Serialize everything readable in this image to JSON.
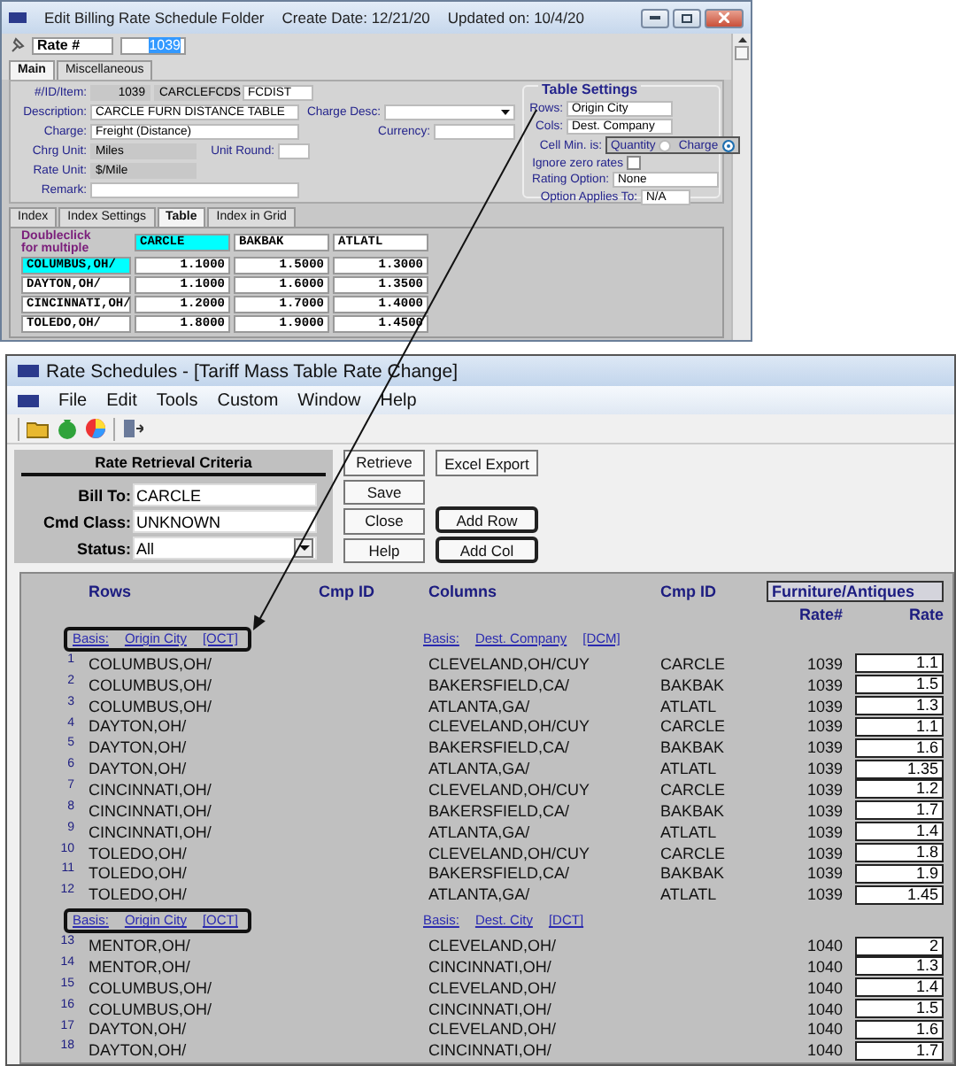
{
  "top_window": {
    "title": "Edit Billing Rate Schedule Folder",
    "create_date": "Create Date: 12/21/20",
    "updated_on": "Updated on: 10/4/20",
    "rate_label": "Rate #",
    "rate_value": "1039",
    "tabs": [
      {
        "label": "Main",
        "selected": true
      },
      {
        "label": "Miscellaneous",
        "selected": false
      }
    ],
    "form": {
      "id_item": {
        "label": "#/ID/Item:",
        "values": [
          "1039",
          "CARCLEFCDS",
          "FCDIST"
        ]
      },
      "description": {
        "label": "Description:",
        "value": "CARCLE FURN DISTANCE TABLE"
      },
      "charge_desc": {
        "label": "Charge Desc:"
      },
      "charge": {
        "label": "Charge:",
        "value": "Freight (Distance)"
      },
      "currency": {
        "label": "Currency:"
      },
      "chrg_unit": {
        "label": "Chrg Unit:",
        "value": "Miles"
      },
      "unit_round": {
        "label": "Unit Round:"
      },
      "rate_unit": {
        "label": "Rate Unit:",
        "value": "$/Mile"
      },
      "remark": {
        "label": "Remark:"
      }
    },
    "table_settings": {
      "title": "Table Settings",
      "rows": {
        "label": "Rows:",
        "value": "Origin City"
      },
      "cols": {
        "label": "Cols:",
        "value": "Dest. Company"
      },
      "cell_min": {
        "label": "Cell Min. is:",
        "options": [
          {
            "label": "Quantity",
            "selected": false
          },
          {
            "label": "Charge",
            "selected": true
          }
        ]
      },
      "ignore_zero": {
        "label": "Ignore zero rates",
        "checked": false
      },
      "rating_option": {
        "label": "Rating Option:",
        "value": "None"
      },
      "option_applies": {
        "label": "Option Applies To:",
        "value": "N/A"
      }
    },
    "inner_tabs": [
      {
        "label": "Index",
        "selected": false
      },
      {
        "label": "Index Settings",
        "selected": false
      },
      {
        "label": "Table",
        "selected": true
      },
      {
        "label": "Index in Grid",
        "selected": false
      }
    ],
    "grid": {
      "hint": "Doubleclick",
      "hint_2": "for multiple",
      "columns": [
        {
          "label": "CARCLE",
          "selected": true
        },
        {
          "label": "BAKBAK",
          "selected": false
        },
        {
          "label": "ATLATL",
          "selected": false
        }
      ],
      "rows": [
        {
          "label": "COLUMBUS,OH/",
          "selected": true,
          "values": [
            "1.1000",
            "1.5000",
            "1.3000"
          ]
        },
        {
          "label": "DAYTON,OH/",
          "selected": false,
          "values": [
            "1.1000",
            "1.6000",
            "1.3500"
          ]
        },
        {
          "label": "CINCINNATI,OH/",
          "selected": false,
          "values": [
            "1.2000",
            "1.7000",
            "1.4000"
          ]
        },
        {
          "label": "TOLEDO,OH/",
          "selected": false,
          "values": [
            "1.8000",
            "1.9000",
            "1.4500"
          ]
        }
      ]
    }
  },
  "bottom_window": {
    "title": "Rate Schedules - [Tariff Mass Table Rate Change]",
    "menu": [
      "File",
      "Edit",
      "Tools",
      "Custom",
      "Window",
      "Help"
    ],
    "criteria": {
      "title": "Rate Retrieval Criteria",
      "fields": [
        {
          "kind": "text",
          "label": "Bill To:",
          "value": "CARCLE"
        },
        {
          "kind": "text",
          "label": "Cmd Class:",
          "value": "UNKNOWN"
        },
        {
          "kind": "select",
          "label": "Status:",
          "value": "All"
        }
      ]
    },
    "button_columns": [
      [
        {
          "label": "Retrieve",
          "emphasized": false
        },
        {
          "label": "Save",
          "emphasized": false
        },
        {
          "label": "Close",
          "emphasized": false
        },
        {
          "label": "Help",
          "emphasized": false
        }
      ],
      [
        {
          "label": "Excel Export",
          "emphasized": false
        },
        {
          "label": "Add Row",
          "emphasized": true
        },
        {
          "label": "Add Col",
          "emphasized": true
        }
      ]
    ],
    "table": {
      "headers": {
        "rows": "Rows",
        "cmp_id_1": "Cmp ID",
        "columns": "Columns",
        "cmp_id_2": "Cmp ID",
        "category": "Furniture/Antiques",
        "rate_no": "Rate#",
        "rate": "Rate"
      },
      "groups": [
        {
          "highlighted": true,
          "row_basis": {
            "label": "Basis:",
            "name": "Origin City",
            "code": "[OCT]"
          },
          "col_basis": {
            "label": "Basis:",
            "name": "Dest. Company",
            "code": "[DCM]"
          },
          "rows": [
            {
              "no": "1",
              "row": "COLUMBUS,OH/",
              "column": "CLEVELAND,OH/CUY",
              "cmp_id": "CARCLE",
              "rate_no": "1039",
              "rate": "1.1"
            },
            {
              "no": "2",
              "row": "COLUMBUS,OH/",
              "column": "BAKERSFIELD,CA/",
              "cmp_id": "BAKBAK",
              "rate_no": "1039",
              "rate": "1.5"
            },
            {
              "no": "3",
              "row": "COLUMBUS,OH/",
              "column": "ATLANTA,GA/",
              "cmp_id": "ATLATL",
              "rate_no": "1039",
              "rate": "1.3"
            },
            {
              "no": "4",
              "row": "DAYTON,OH/",
              "column": "CLEVELAND,OH/CUY",
              "cmp_id": "CARCLE",
              "rate_no": "1039",
              "rate": "1.1"
            },
            {
              "no": "5",
              "row": "DAYTON,OH/",
              "column": "BAKERSFIELD,CA/",
              "cmp_id": "BAKBAK",
              "rate_no": "1039",
              "rate": "1.6"
            },
            {
              "no": "6",
              "row": "DAYTON,OH/",
              "column": "ATLANTA,GA/",
              "cmp_id": "ATLATL",
              "rate_no": "1039",
              "rate": "1.35"
            },
            {
              "no": "7",
              "row": "CINCINNATI,OH/",
              "column": "CLEVELAND,OH/CUY",
              "cmp_id": "CARCLE",
              "rate_no": "1039",
              "rate": "1.2"
            },
            {
              "no": "8",
              "row": "CINCINNATI,OH/",
              "column": "BAKERSFIELD,CA/",
              "cmp_id": "BAKBAK",
              "rate_no": "1039",
              "rate": "1.7"
            },
            {
              "no": "9",
              "row": "CINCINNATI,OH/",
              "column": "ATLANTA,GA/",
              "cmp_id": "ATLATL",
              "rate_no": "1039",
              "rate": "1.4"
            },
            {
              "no": "10",
              "row": "TOLEDO,OH/",
              "column": "CLEVELAND,OH/CUY",
              "cmp_id": "CARCLE",
              "rate_no": "1039",
              "rate": "1.8"
            },
            {
              "no": "11",
              "row": "TOLEDO,OH/",
              "column": "BAKERSFIELD,CA/",
              "cmp_id": "BAKBAK",
              "rate_no": "1039",
              "rate": "1.9"
            },
            {
              "no": "12",
              "row": "TOLEDO,OH/",
              "column": "ATLANTA,GA/",
              "cmp_id": "ATLATL",
              "rate_no": "1039",
              "rate": "1.45"
            }
          ]
        },
        {
          "highlighted": true,
          "row_basis": {
            "label": "Basis:",
            "name": "Origin City",
            "code": "[OCT]"
          },
          "col_basis": {
            "label": "Basis:",
            "name": "Dest. City",
            "code": "[DCT]"
          },
          "rows": [
            {
              "no": "13",
              "row": "MENTOR,OH/",
              "column": "CLEVELAND,OH/",
              "rate_no": "1040",
              "rate": "2"
            },
            {
              "no": "14",
              "row": "MENTOR,OH/",
              "column": "CINCINNATI,OH/",
              "rate_no": "1040",
              "rate": "1.3"
            },
            {
              "no": "15",
              "row": "COLUMBUS,OH/",
              "column": "CLEVELAND,OH/",
              "rate_no": "1040",
              "rate": "1.4"
            },
            {
              "no": "16",
              "row": "COLUMBUS,OH/",
              "column": "CINCINNATI,OH/",
              "rate_no": "1040",
              "rate": "1.5"
            },
            {
              "no": "17",
              "row": "DAYTON,OH/",
              "column": "CLEVELAND,OH/",
              "rate_no": "1040",
              "rate": "1.6"
            },
            {
              "no": "18",
              "row": "DAYTON,OH/",
              "column": "CINCINNATI,OH/",
              "rate_no": "1040",
              "rate": "1.7"
            }
          ]
        }
      ]
    }
  }
}
